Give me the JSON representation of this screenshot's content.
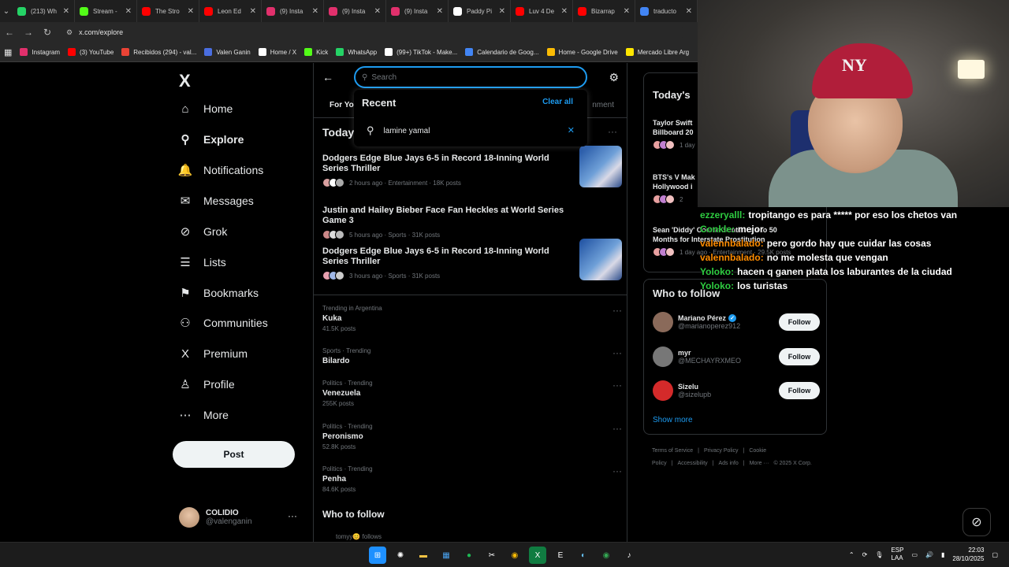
{
  "browser": {
    "tabs": [
      {
        "title": "(213) Wh",
        "color": "#25d366"
      },
      {
        "title": "Stream -",
        "color": "#53fc18"
      },
      {
        "title": "The Stro",
        "color": "#ff0000"
      },
      {
        "title": "Leon Ed",
        "color": "#ff0000"
      },
      {
        "title": "(9) Insta",
        "color": "#e1306c"
      },
      {
        "title": "(9) Insta",
        "color": "#e1306c"
      },
      {
        "title": "(9) Insta",
        "color": "#e1306c"
      },
      {
        "title": "Paddy Pi",
        "color": "#ffffff"
      },
      {
        "title": "Luv 4 De",
        "color": "#ff0000"
      },
      {
        "title": "Bizarrap",
        "color": "#ff0000"
      },
      {
        "title": "traducto",
        "color": "#4285f4"
      }
    ],
    "url": "x.com/explore",
    "bookmarks": [
      {
        "label": "Instagram",
        "color": "#e1306c"
      },
      {
        "label": "(3) YouTube",
        "color": "#ff0000"
      },
      {
        "label": "Recibidos (294) - val...",
        "color": "#ea4335"
      },
      {
        "label": "Valen Ganin",
        "color": "#4a6ee0"
      },
      {
        "label": "Home / X",
        "color": "#ffffff"
      },
      {
        "label": "Kick",
        "color": "#53fc18"
      },
      {
        "label": "WhatsApp",
        "color": "#25d366"
      },
      {
        "label": "(99+) TikTok - Make...",
        "color": "#ffffff"
      },
      {
        "label": "Calendario de Goog...",
        "color": "#4285f4"
      },
      {
        "label": "Home - Google Drive",
        "color": "#fbbc04"
      },
      {
        "label": "Mercado Libre Arg",
        "color": "#ffe600"
      }
    ]
  },
  "nav": {
    "logo": "X",
    "items": [
      {
        "label": "Home",
        "icon": "⌂"
      },
      {
        "label": "Explore",
        "icon": "⚲"
      },
      {
        "label": "Notifications",
        "icon": "🔔"
      },
      {
        "label": "Messages",
        "icon": "✉"
      },
      {
        "label": "Grok",
        "icon": "⊘"
      },
      {
        "label": "Lists",
        "icon": "☰"
      },
      {
        "label": "Bookmarks",
        "icon": "⚑"
      },
      {
        "label": "Communities",
        "icon": "⚇"
      },
      {
        "label": "Premium",
        "icon": "X"
      },
      {
        "label": "Profile",
        "icon": "♙"
      },
      {
        "label": "More",
        "icon": "⋯"
      }
    ],
    "post_label": "Post",
    "account": {
      "name": "COLIDIO",
      "handle": "@valenganin"
    }
  },
  "search": {
    "placeholder": "Search",
    "recent_heading": "Recent",
    "clear_all": "Clear all",
    "recent_item": "lamine yamal"
  },
  "main": {
    "tab_foryou": "For You",
    "tab_entertainment": "nment",
    "today_heading": "Today",
    "stories": [
      {
        "title": "Dodgers Edge Blue Jays 6-5 in Record 18-Inning World Series Thriller",
        "meta": "2 hours ago · Entertainment · 18K posts"
      },
      {
        "title": "Justin and Hailey Bieber Face Fan Heckles at World Series Game 3",
        "meta": "5 hours ago · Sports · 31K posts"
      },
      {
        "title": "Dodgers Edge Blue Jays 6-5 in Record 18-Inning World Series Thriller",
        "meta": "3 hours ago · Sports · 31K posts"
      }
    ],
    "trends": [
      {
        "category": "Trending in Argentina",
        "name": "Kuka",
        "posts": "41.5K posts"
      },
      {
        "category": "Sports · Trending",
        "name": "Bilardo",
        "posts": ""
      },
      {
        "category": "Politics · Trending",
        "name": "Venezuela",
        "posts": "255K posts"
      },
      {
        "category": "Politics · Trending",
        "name": "Peronismo",
        "posts": "52.8K posts"
      },
      {
        "category": "Politics · Trending",
        "name": "Penha",
        "posts": "84.6K posts"
      }
    ],
    "who_to_follow": "Who to follow",
    "follows_line": "tomyy😊 follows"
  },
  "right": {
    "today_heading": "Today's",
    "news": [
      {
        "title": "Taylor Swift\nBillboard 20",
        "meta": "1 day"
      },
      {
        "title": "BTS's V Mak\nHollywood i",
        "meta": "2"
      },
      {
        "title": "Sean 'Diddy' Combs Sentenced to 50\nMonths for Interstate Prostitution",
        "meta": "1 day ago · Entertainment · 29.5K posts"
      }
    ],
    "who_heading": "Who to follow",
    "follows": [
      {
        "name": "Mariano Pérez",
        "handle": "@marianoperez912",
        "verified": true,
        "button": "Follow"
      },
      {
        "name": "myr",
        "handle": "@MECHAYRXMEO",
        "verified": false,
        "button": "Follow"
      },
      {
        "name": "Sizelu",
        "handle": "@sizelupb",
        "verified": false,
        "button": "Follow"
      }
    ],
    "show_more": "Show more",
    "footer": [
      "Terms of Service",
      "|",
      "Privacy Policy",
      "|",
      "Cookie Policy",
      "|",
      "Accessibility",
      "|",
      "Ads info",
      "|",
      "More ···",
      "© 2025 X Corp."
    ]
  },
  "chat": [
    {
      "user": "ezzeryalll:",
      "color": "#2ecc40",
      "msg": "tropitango es para ***** por eso los chetos van"
    },
    {
      "user": "Conkle:",
      "color": "#2ecc40",
      "msg": "mejor"
    },
    {
      "user": "valennbalado:",
      "color": "#ff8c00",
      "msg": "pero gordo hay que cuidar las cosas"
    },
    {
      "user": "valennbalado:",
      "color": "#ff8c00",
      "msg": "no me molesta que vengan"
    },
    {
      "user": "Yoloko:",
      "color": "#2ecc40",
      "msg": "hacen q ganen plata los laburantes de la ciudad"
    },
    {
      "user": "Yoloko:",
      "color": "#2ecc40",
      "msg": "los turistas"
    }
  ],
  "taskbar": {
    "lang": "ESP\nLAA",
    "time": "22:03",
    "date": "28/10/2025"
  }
}
